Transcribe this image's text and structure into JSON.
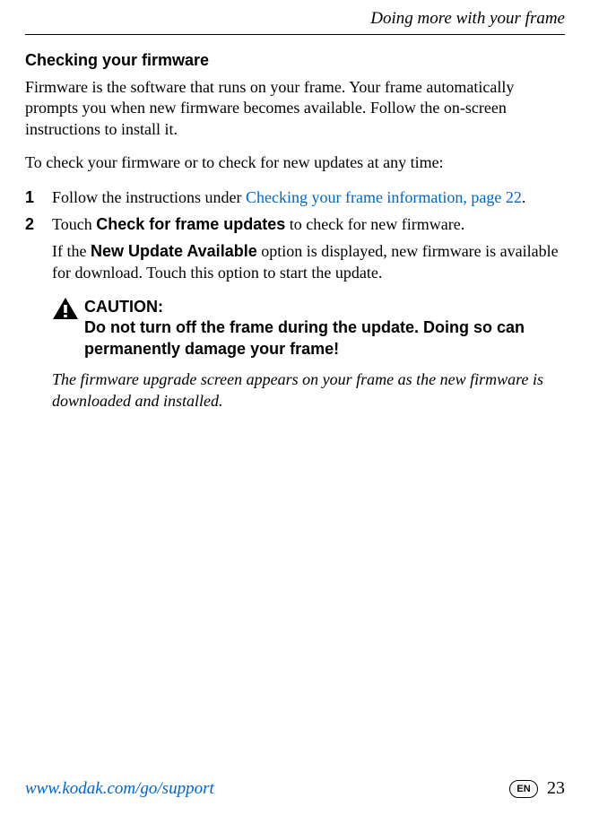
{
  "header": {
    "section_title": "Doing more with your frame"
  },
  "content": {
    "heading": "Checking your firmware",
    "intro": "Firmware is the software that runs on your frame. Your frame automatically prompts you when new firmware becomes available. Follow the on-screen instructions to install it.",
    "check_anytime": "To check your firmware or to check for new updates at any time:",
    "steps": [
      {
        "num": "1",
        "prefix": "Follow the instructions under ",
        "link": "Checking your frame information, page 22",
        "suffix": "."
      },
      {
        "num": "2",
        "prefix": "Touch ",
        "bold": "Check for frame updates",
        "suffix": " to check for new firmware."
      }
    ],
    "update_para_prefix": "If the ",
    "update_para_bold": "New Update Available",
    "update_para_suffix": " option is displayed, new firmware is available for download. Touch this option to start the update.",
    "caution_label": "CAUTION:",
    "caution_body": "Do not turn off the frame during the update. Doing so can permanently damage your frame!",
    "note": "The firmware upgrade screen appears on your frame as the new firmware is downloaded and installed."
  },
  "footer": {
    "url": "www.kodak.com/go/support",
    "lang": "EN",
    "page": "23"
  }
}
